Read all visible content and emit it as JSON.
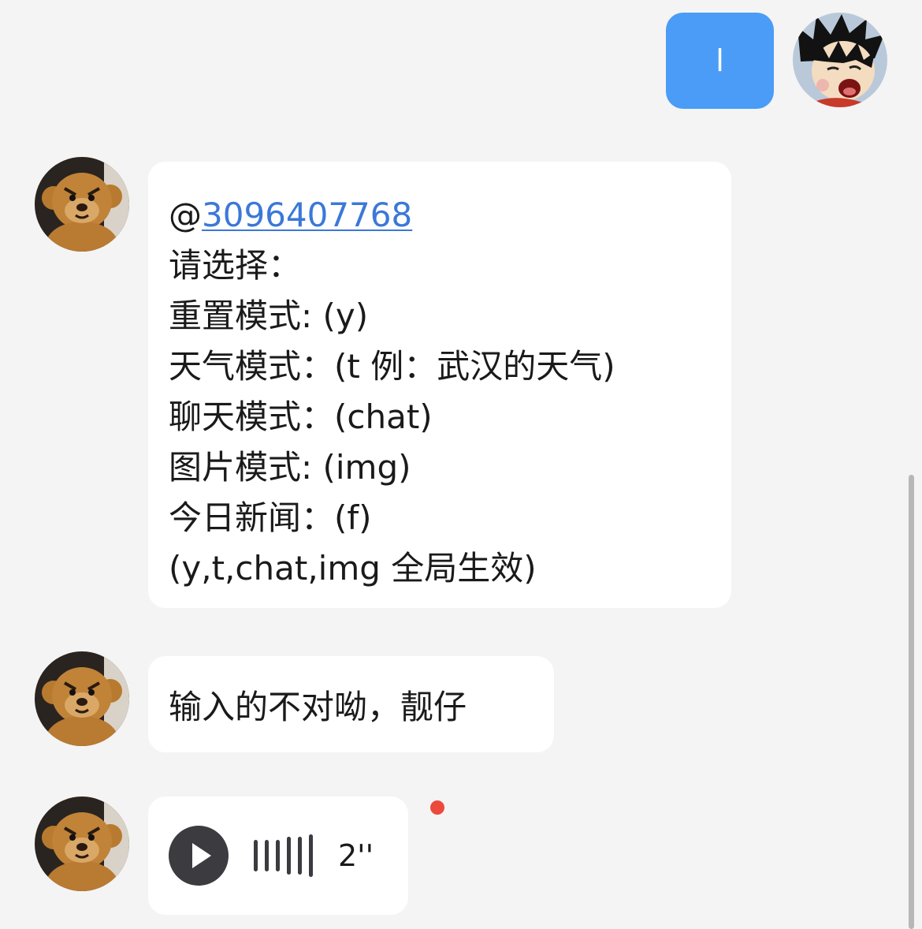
{
  "colors": {
    "background": "#f4f4f4",
    "outgoing_bubble": "#4a9cf6",
    "incoming_bubble": "#ffffff",
    "link": "#3b78d8",
    "unread_dot": "#ec4a3c"
  },
  "messages": [
    {
      "direction": "outgoing",
      "avatar": "cartoon-boy-avatar",
      "text": "l"
    },
    {
      "direction": "incoming",
      "avatar": "teddy-monkey-avatar",
      "mention_prefix": "@",
      "mention_id": "3096407768",
      "lines": [
        "请选择：",
        "重置模式: (y)",
        "天气模式：(t 例：武汉的天气)",
        "聊天模式：(chat)",
        "图片模式: (img)",
        "今日新闻：(f)",
        "(y,t,chat,img 全局生效)"
      ]
    },
    {
      "direction": "incoming",
      "avatar": "teddy-monkey-avatar",
      "text": "输入的不对呦，靓仔"
    },
    {
      "direction": "incoming",
      "avatar": "teddy-monkey-avatar",
      "type": "voice",
      "duration": "2''",
      "unread": true,
      "icon": "play-icon"
    }
  ]
}
